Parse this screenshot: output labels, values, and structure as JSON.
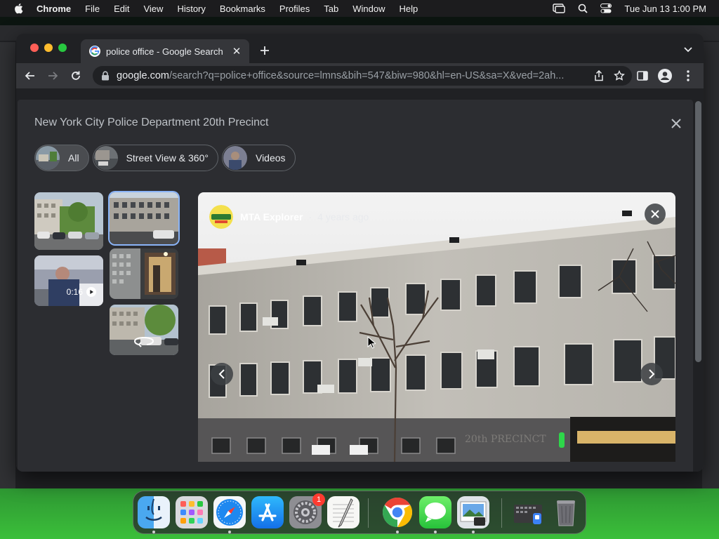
{
  "menubar": {
    "app_name": "Chrome",
    "menus": [
      "File",
      "Edit",
      "View",
      "History",
      "Bookmarks",
      "Profiles",
      "Tab",
      "Window",
      "Help"
    ],
    "datetime": "Tue Jun 13  1:00 PM"
  },
  "browser": {
    "tab_title": "police office - Google Search",
    "url_host": "google.com",
    "url_path": "/search?q=police+office&source=lmns&bih=547&biw=980&hl=en-US&sa=X&ved=2ah..."
  },
  "overlay": {
    "title": "New York City Police Department 20th Precinct",
    "chips": [
      {
        "label": "All",
        "active": true
      },
      {
        "label": "Street View & 360°",
        "active": false
      },
      {
        "label": "Videos",
        "active": false
      }
    ],
    "video_duration": "0:16"
  },
  "viewer": {
    "author": "MTA Explorer",
    "separator": "·",
    "time_ago": "4 years ago",
    "sign_text": "20th PRECINCT"
  },
  "dock": {
    "apps": [
      "Finder",
      "Launchpad",
      "Safari",
      "App Store",
      "System Settings",
      "TextEdit",
      "Google Chrome",
      "Messages",
      "Preview",
      "Screenshot",
      "Trash"
    ],
    "settings_badge": "1"
  },
  "colors": {
    "accent_blue": "#8ab4f8",
    "page_bg": "#202124",
    "overlay_bg": "#2c2d31"
  }
}
